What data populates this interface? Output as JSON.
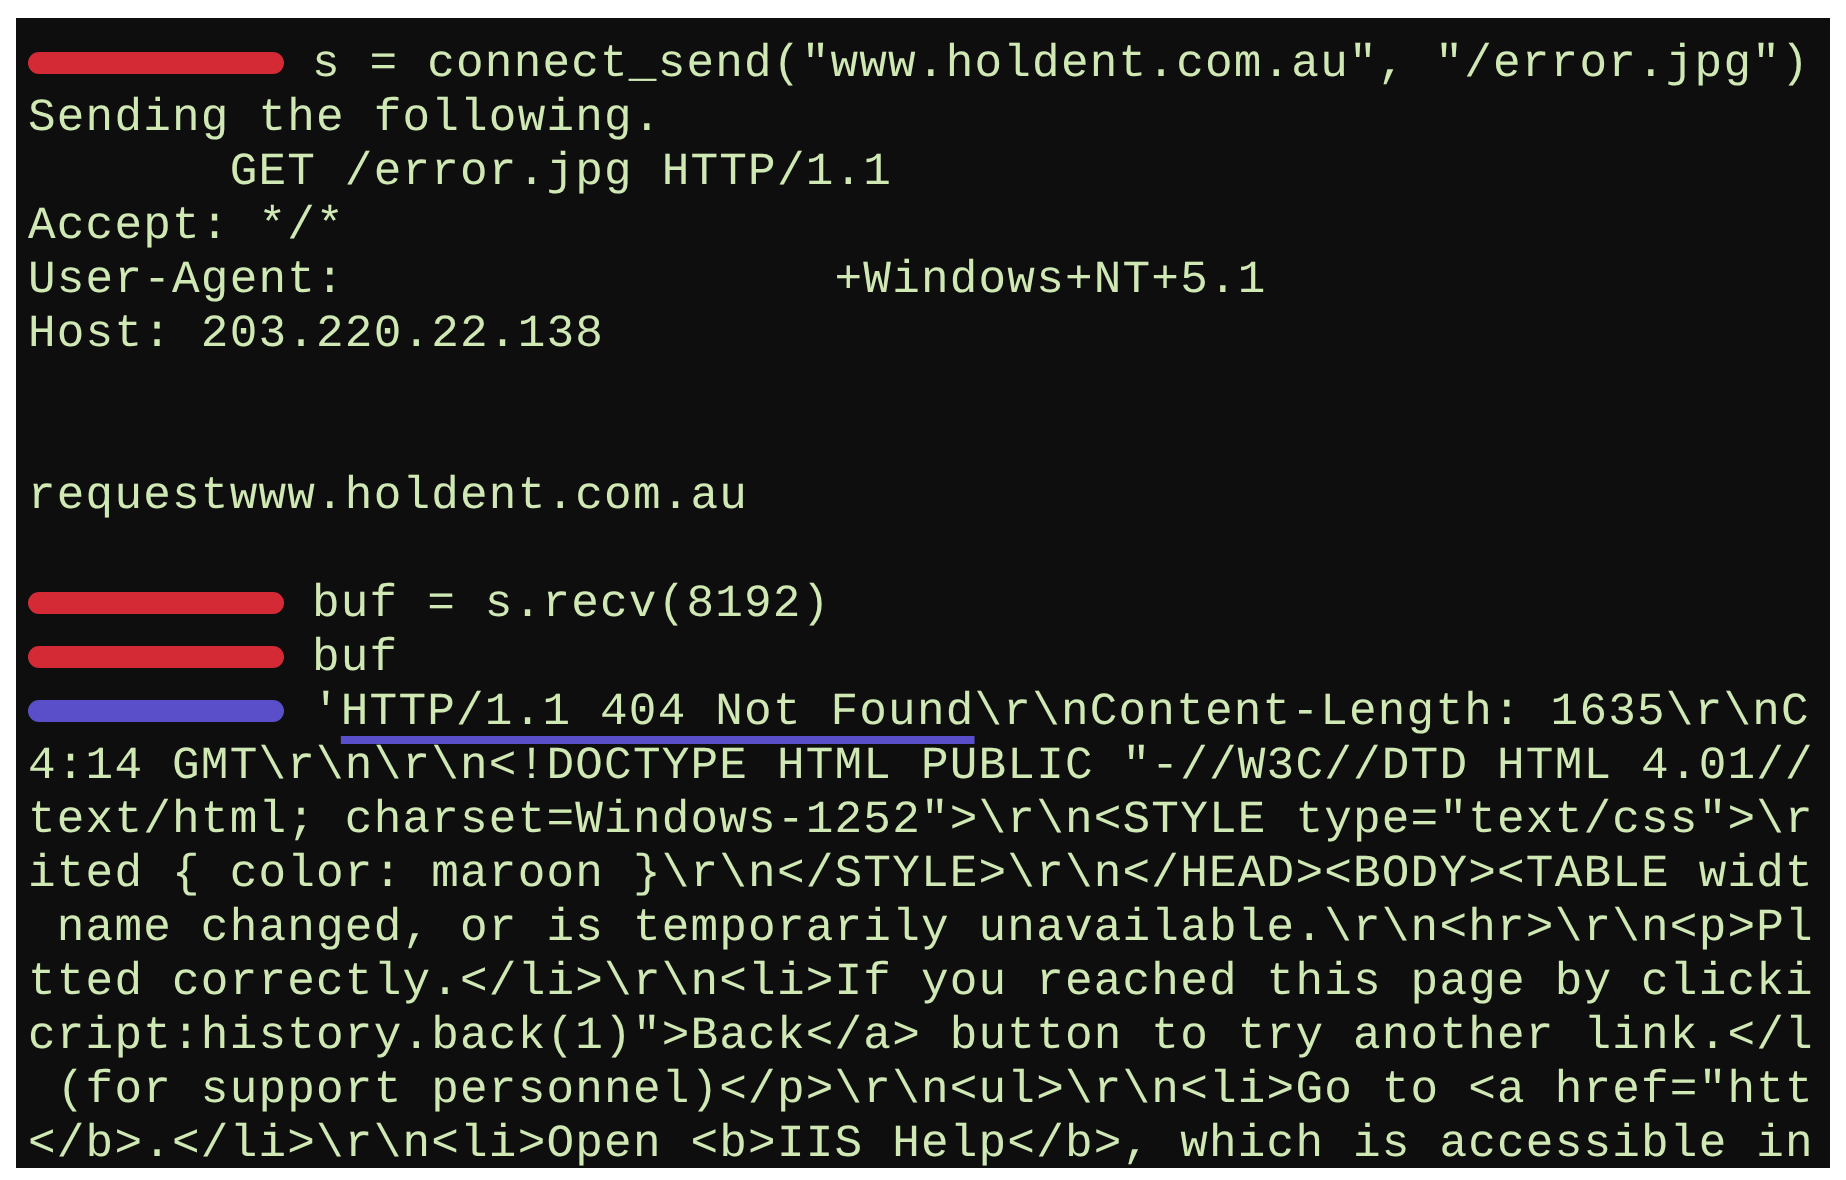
{
  "terminal": {
    "lines": [
      {
        "kind": "text",
        "marker": {
          "color": "#d42a36"
        },
        "text": "s = connect_send(\"www.holdent.com.au\", \"/error.jpg\")"
      },
      {
        "kind": "text",
        "text": "Sending the following."
      },
      {
        "kind": "text",
        "text": "       GET /error.jpg HTTP/1.1"
      },
      {
        "kind": "text",
        "text": "Accept: */*"
      },
      {
        "kind": "text",
        "text": "User-Agent:                 +Windows+NT+5.1"
      },
      {
        "kind": "text",
        "text": "Host: 203.220.22.138"
      },
      {
        "kind": "blank"
      },
      {
        "kind": "blank"
      },
      {
        "kind": "text",
        "text": "requestwww.holdent.com.au"
      },
      {
        "kind": "blank"
      },
      {
        "kind": "text",
        "marker": {
          "color": "#d42a36"
        },
        "text": "buf = s.recv(8192)"
      },
      {
        "kind": "text",
        "marker": {
          "color": "#d42a36"
        },
        "text": "buf"
      },
      {
        "kind": "parts",
        "marker": {
          "color": "#5a4fc8"
        },
        "parts": [
          {
            "text": "'",
            "underlined": false
          },
          {
            "text": "HTTP/1.1 404 Not Found",
            "underlined": true
          },
          {
            "text": "\\r\\nContent-Length: 1635\\r\\nC",
            "underlined": false
          }
        ]
      },
      {
        "kind": "text",
        "text": "4:14 GMT\\r\\n\\r\\n<!DOCTYPE HTML PUBLIC \"-//W3C//DTD HTML 4.01//"
      },
      {
        "kind": "text",
        "text": "text/html; charset=Windows-1252\">\\r\\n<STYLE type=\"text/css\">\\r"
      },
      {
        "kind": "text",
        "text": "ited { color: maroon }\\r\\n</STYLE>\\r\\n</HEAD><BODY><TABLE widt"
      },
      {
        "kind": "text",
        "text": " name changed, or is temporarily unavailable.\\r\\n<hr>\\r\\n<p>Pl"
      },
      {
        "kind": "text",
        "text": "tted correctly.</li>\\r\\n<li>If you reached this page by clicki"
      },
      {
        "kind": "text",
        "text": "cript:history.back(1)\">Back</a> button to try another link.</l"
      },
      {
        "kind": "text",
        "text": " (for support personnel)</p>\\r\\n<ul>\\r\\n<li>Go to <a href=\"htt"
      },
      {
        "kind": "text",
        "text": "</b>.</li>\\r\\n<li>Open <b>IIS Help</b>, which is accessible in"
      }
    ]
  }
}
